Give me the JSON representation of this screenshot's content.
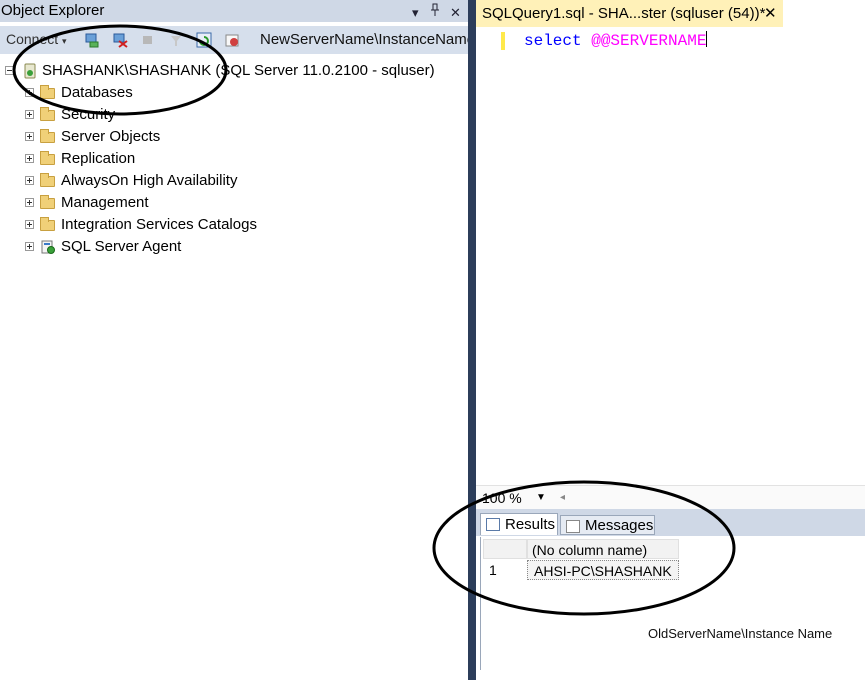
{
  "object_explorer": {
    "title": "Object Explorer",
    "title_buttons": {
      "dropdown": "▾",
      "pin": "📌",
      "close": "✕"
    },
    "toolbar": {
      "connect_label": "Connect",
      "connect_arrow": "▾"
    },
    "root": {
      "label": "SHASHANK\\SHASHANK (SQL Server 11.0.2100 - sqluser)"
    },
    "nodes": [
      {
        "label": "Databases"
      },
      {
        "label": "Security"
      },
      {
        "label": "Server Objects"
      },
      {
        "label": "Replication"
      },
      {
        "label": "AlwaysOn High Availability"
      },
      {
        "label": "Management"
      },
      {
        "label": "Integration Services Catalogs"
      },
      {
        "label": "SQL Server Agent"
      }
    ]
  },
  "document": {
    "tab_title": "SQLQuery1.sql - SHA...ster (sqluser (54))*",
    "tab_close": "✕",
    "code_keyword": "select",
    "code_variable": "@@SERVERNAME"
  },
  "zoom": {
    "value": "100 %",
    "arrow": "▼",
    "scroll_left": "◂"
  },
  "results_tabs": {
    "results": "Results",
    "messages": "Messages"
  },
  "results_grid": {
    "column_header": "(No column name)",
    "rows": [
      {
        "num": "1",
        "value": "AHSI-PC\\SHASHANK"
      }
    ]
  },
  "annotations": {
    "new_server": "NewServerName\\InstanceName",
    "old_server": "OldServerName\\Instance Name"
  },
  "colors": {
    "accent_tab": "#fff1b8",
    "splitter": "#2c3d5a",
    "keyword": "#0000ff",
    "variable": "#ff00ff"
  }
}
